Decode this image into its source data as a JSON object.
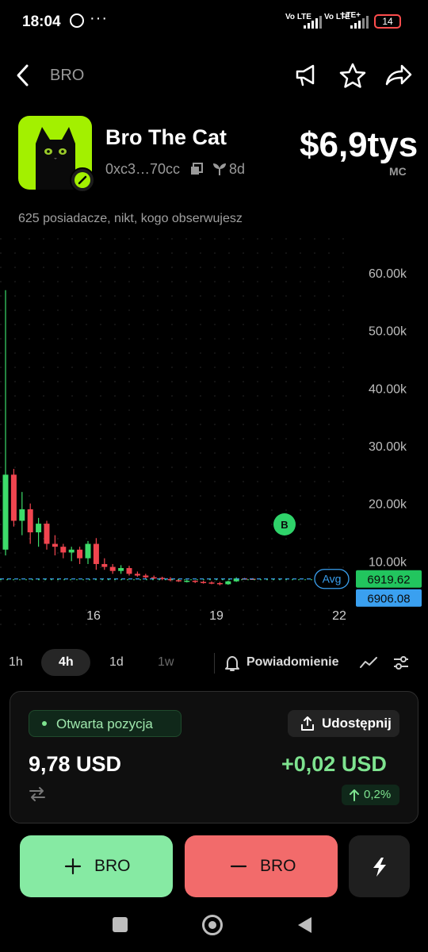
{
  "status_bar": {
    "time": "18:04",
    "sim1": "Vo LTE",
    "sim2": "Vo LTE",
    "network": "LTE+",
    "battery": "14"
  },
  "header": {
    "title": "BRO",
    "icons": [
      "back-arrow-icon",
      "megaphone-icon",
      "star-icon",
      "share-arrow-icon"
    ]
  },
  "token": {
    "name": "Bro The Cat",
    "address": "0xc3…70cc",
    "age": "8d",
    "market_cap": "$6,9tys",
    "market_cap_label": "MC",
    "holders_text": "625 posiadacze, nikt, kogo obserwujesz"
  },
  "chart_data": {
    "type": "candlestick",
    "y_ticks": [
      "60.00k",
      "50.00k",
      "40.00k",
      "30.00k",
      "20.00k",
      "10.00k"
    ],
    "x_ticks": [
      "16",
      "19",
      "22"
    ],
    "ylim": [
      0,
      60000
    ],
    "avg_label": "Avg",
    "price_high_label": "6919.62",
    "price_low_label": "6906.08",
    "marker_label": "B",
    "candles": [
      {
        "o": 12000,
        "h": 57000,
        "l": 11000,
        "c": 25000
      },
      {
        "o": 25000,
        "h": 26000,
        "l": 16000,
        "c": 17000
      },
      {
        "o": 17000,
        "h": 22000,
        "l": 14500,
        "c": 19000
      },
      {
        "o": 19000,
        "h": 20000,
        "l": 13000,
        "c": 15000
      },
      {
        "o": 15000,
        "h": 17500,
        "l": 12500,
        "c": 16500
      },
      {
        "o": 16500,
        "h": 17000,
        "l": 12000,
        "c": 13000
      },
      {
        "o": 13000,
        "h": 14500,
        "l": 11000,
        "c": 12500
      },
      {
        "o": 12500,
        "h": 13000,
        "l": 10500,
        "c": 11500
      },
      {
        "o": 11500,
        "h": 12500,
        "l": 10000,
        "c": 12000
      },
      {
        "o": 12000,
        "h": 12500,
        "l": 9500,
        "c": 10500
      },
      {
        "o": 10500,
        "h": 13500,
        "l": 9500,
        "c": 13000
      },
      {
        "o": 13000,
        "h": 14000,
        "l": 8500,
        "c": 9500
      },
      {
        "o": 9500,
        "h": 10500,
        "l": 8500,
        "c": 9000
      },
      {
        "o": 9000,
        "h": 9500,
        "l": 7800,
        "c": 8300
      },
      {
        "o": 8300,
        "h": 9300,
        "l": 7800,
        "c": 8800
      },
      {
        "o": 8800,
        "h": 9200,
        "l": 7500,
        "c": 7800
      },
      {
        "o": 7800,
        "h": 8200,
        "l": 7300,
        "c": 7500
      },
      {
        "o": 7500,
        "h": 7800,
        "l": 7000,
        "c": 7200
      },
      {
        "o": 7200,
        "h": 7500,
        "l": 6900,
        "c": 7100
      },
      {
        "o": 7100,
        "h": 7300,
        "l": 6700,
        "c": 6900
      },
      {
        "o": 6900,
        "h": 7200,
        "l": 6500,
        "c": 6700
      },
      {
        "o": 6700,
        "h": 6950,
        "l": 6400,
        "c": 6500
      },
      {
        "o": 6500,
        "h": 6800,
        "l": 6300,
        "c": 6600
      },
      {
        "o": 6600,
        "h": 6700,
        "l": 6200,
        "c": 6400
      },
      {
        "o": 6400,
        "h": 6600,
        "l": 6100,
        "c": 6300
      },
      {
        "o": 6300,
        "h": 6500,
        "l": 6000,
        "c": 6200
      },
      {
        "o": 6200,
        "h": 6400,
        "l": 5800,
        "c": 6000
      },
      {
        "o": 6000,
        "h": 6600,
        "l": 5900,
        "c": 6500
      },
      {
        "o": 6500,
        "h": 7200,
        "l": 6400,
        "c": 7000
      },
      {
        "o": 7000,
        "h": 7100,
        "l": 6800,
        "c": 6950
      },
      {
        "o": 6950,
        "h": 7050,
        "l": 6850,
        "c": 6920
      }
    ]
  },
  "timeframes": {
    "items": [
      "1h",
      "4h",
      "1d",
      "1w"
    ],
    "active": "4h",
    "alert_label": "Powiadomienie"
  },
  "position": {
    "status_label": "Otwarta pozycja",
    "share_label": "Udostępnij",
    "amount": "9,78 USD",
    "pnl": "+0,02 USD",
    "pnl_pct": "0,2%"
  },
  "actions": {
    "buy_label": "BRO",
    "sell_label": "BRO"
  },
  "colors": {
    "up": "#3ddc6a",
    "down": "#f0454f",
    "buy_bg": "#86eaa3",
    "sell_bg": "#f26b6b",
    "accent_blue": "#3aa0f0"
  }
}
